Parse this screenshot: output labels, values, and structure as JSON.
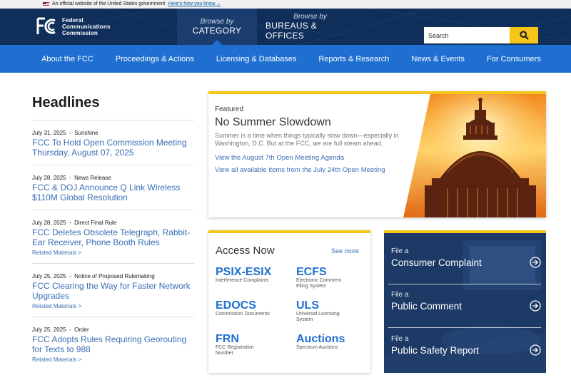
{
  "gov_banner": {
    "text": "An official website of the United States government",
    "link": "Here's how you know"
  },
  "header": {
    "logo_line1": "Federal",
    "logo_line2": "Communications",
    "logo_line3": "Commission",
    "browse_category_small": "Browse by",
    "browse_category_big": "CATEGORY",
    "browse_bureaus_small": "Browse by",
    "browse_bureaus_big": "BUREAUS & OFFICES",
    "search_placeholder": "Search"
  },
  "nav": {
    "items": [
      "About the FCC",
      "Proceedings & Actions",
      "Licensing & Databases",
      "Reports & Research",
      "News & Events",
      "For Consumers"
    ]
  },
  "headlines": {
    "title": "Headlines",
    "items": [
      {
        "date": "July 31, 2025",
        "type": "Sunshine",
        "title": "FCC To Hold Open Commission Meeting Thursday, August 07, 2025",
        "related": ""
      },
      {
        "date": "July 28, 2025",
        "type": "News Release",
        "title": "FCC & DOJ Announce Q Link Wireless $110M Global Resolution",
        "related": ""
      },
      {
        "date": "July 28, 2025",
        "type": "Direct Final Rule",
        "title": "FCC Deletes Obsolete Telegraph, Rabbit-Ear Receiver, Phone Booth Rules",
        "related": "Related Materials >"
      },
      {
        "date": "July 25, 2025",
        "type": "Notice of Proposed Rulemaking",
        "title": "FCC Clearing the Way for Faster Network Upgrades",
        "related": "Related Materials >"
      },
      {
        "date": "July 25, 2025",
        "type": "Order",
        "title": "FCC Adopts Rules Requiring Georouting for Texts to 988",
        "related": "Related Materials >"
      }
    ]
  },
  "featured": {
    "label": "Featured",
    "title": "No Summer Slowdown",
    "description": "Summer is a time when things typically slow down—especially in Washington, D.C. But at the FCC, we are full steam ahead.",
    "link1": "View the August 7th Open Meeting Agenda",
    "link2": "View all available items from the July 24th Open Meeting"
  },
  "access": {
    "title": "Access Now",
    "see_more": "See more",
    "items": [
      {
        "code": "PSIX-ESIX",
        "desc": "Interference Complaints"
      },
      {
        "code": "ECFS",
        "desc": "Electronic Comment Filing System"
      },
      {
        "code": "EDOCS",
        "desc": "Commission Documents"
      },
      {
        "code": "ULS",
        "desc": "Universal Licensing System"
      },
      {
        "code": "FRN",
        "desc": "FCC Registration Number"
      },
      {
        "code": "Auctions",
        "desc": "Spectrum Auctions"
      }
    ]
  },
  "file_a": {
    "items": [
      {
        "small": "File a",
        "big": "Consumer Complaint"
      },
      {
        "small": "File a",
        "big": "Public Comment"
      },
      {
        "small": "File a",
        "big": "Public Safety Report"
      }
    ]
  },
  "colors": {
    "header_bg": "#0f2e5a",
    "nav_bg": "#1f6fd1",
    "accent_yellow": "#f5c518",
    "link_blue": "#3a6eb5"
  }
}
